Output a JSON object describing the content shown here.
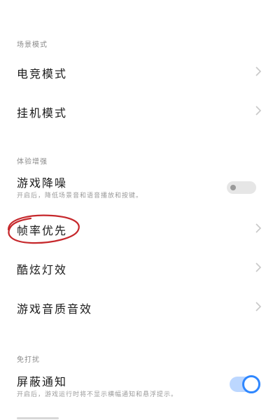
{
  "sections": [
    {
      "header": "场景模式",
      "items": [
        {
          "title": "电竞模式"
        },
        {
          "title": "挂机模式"
        }
      ]
    },
    {
      "header": "体验增强",
      "items": [
        {
          "title": "游戏降噪",
          "desc": "开启后，降低场景音和语音播放和按键。",
          "toggle": false
        },
        {
          "title": "帧率优先"
        },
        {
          "title": "酷炫灯效"
        },
        {
          "title": "游戏音质音效"
        }
      ]
    },
    {
      "header": "免打扰",
      "items": [
        {
          "title": "屏蔽通知",
          "desc": "开启后，游戏运行时将不显示横幅通知和悬浮提示。",
          "toggle": true
        }
      ]
    }
  ],
  "colors": {
    "accent": "#2f87ff",
    "annotation": "#c6282c"
  }
}
